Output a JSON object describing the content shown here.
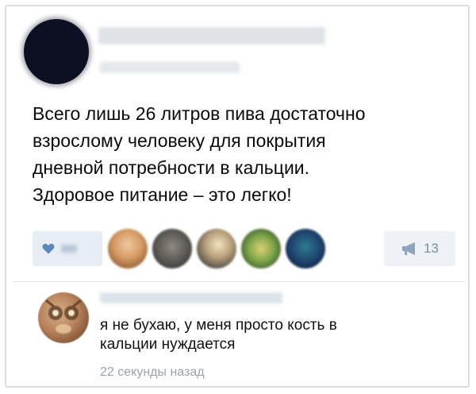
{
  "post": {
    "text_lines": [
      "Всего лишь 26 литров пива достаточно",
      "взрослому человеку для покрытия",
      "дневной потребности в кальции.",
      "Здоровое питание – это легко!"
    ]
  },
  "actions": {
    "like_icon": "heart-icon",
    "share_icon": "megaphone-icon",
    "share_count": "13"
  },
  "comment": {
    "text_lines": [
      "я не бухаю, у меня просто кость в",
      "кальции нуждается"
    ],
    "time": "22 секунды назад"
  },
  "colors": {
    "accent": "#5b88bd",
    "like_bg": "#e7edf4",
    "muted": "#9aa3ad"
  }
}
